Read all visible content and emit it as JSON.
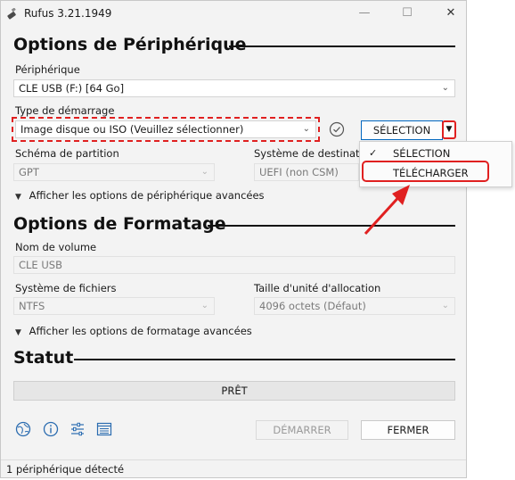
{
  "window": {
    "title": "Rufus 3.21.1949",
    "minimize": "—",
    "maximize": "☐",
    "close": "✕"
  },
  "device_options": {
    "section_title": "Options de Périphérique",
    "device_label": "Périphérique",
    "device_value": "CLE USB (F:) [64 Go]",
    "boot_type_label": "Type de démarrage",
    "boot_type_value": "Image disque ou ISO (Veuillez sélectionner)",
    "select_button": "SÉLECTION",
    "partition_label": "Schéma de partition",
    "partition_value": "GPT",
    "target_label": "Système de destination",
    "target_value": "UEFI (non CSM)",
    "advanced_toggle": "Afficher les options de périphérique avancées"
  },
  "format_options": {
    "section_title": "Options de Formatage",
    "volume_label": "Nom de volume",
    "volume_value": "CLE USB",
    "fs_label": "Système de fichiers",
    "fs_value": "NTFS",
    "cluster_label": "Taille d'unité d'allocation",
    "cluster_value": "4096 octets (Défaut)",
    "advanced_toggle": "Afficher les options de formatage avancées"
  },
  "status": {
    "section_title": "Statut",
    "progress_text": "PRÊT",
    "progress": 0
  },
  "actions": {
    "start": "DÉMARRER",
    "close": "FERMER"
  },
  "footer": {
    "text": "1 périphérique détecté"
  },
  "dropdown_menu": {
    "items": [
      {
        "label": "SÉLECTION",
        "checked": true
      },
      {
        "label": "TÉLÉCHARGER",
        "checked": false
      }
    ]
  },
  "icons": {
    "app": "usb-drive-icon",
    "tools": [
      "globe-icon",
      "info-icon",
      "settings-sliders-icon",
      "log-icon"
    ],
    "verify": "check-circle-icon"
  },
  "colors": {
    "accent": "#0067c0",
    "annotation": "#e02020"
  }
}
